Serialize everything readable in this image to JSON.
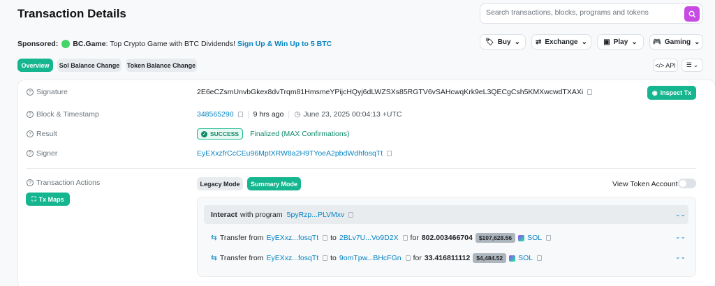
{
  "header": {
    "title": "Transaction Details",
    "search_placeholder": "Search transactions, blocks, programs and tokens"
  },
  "sponsor": {
    "prefix": "Sponsored:",
    "brand": "BC.Game",
    "text": ": Top Crypto Game with BTC Dividends!",
    "cta": "Sign Up & Win Up to 5 BTC"
  },
  "nav_pills": [
    {
      "label": "Buy",
      "icon": "tag-icon"
    },
    {
      "label": "Exchange",
      "icon": "exchange-icon"
    },
    {
      "label": "Play",
      "icon": "play-icon"
    },
    {
      "label": "Gaming",
      "icon": "gamepad-icon"
    }
  ],
  "tabs": {
    "overview": "Overview",
    "sol_balance": "Sol Balance Change",
    "token_balance": "Token Balance Change"
  },
  "api_label": "API",
  "details": {
    "signature_label": "Signature",
    "signature": "2E6eCZsmUnvbGkex8dvTrqm81HmsmeYPijcHQyj6dLWZSXs85RGTV6vSAHcwqKrk9eL3QECgCsh5KMXwcwdTXAXi",
    "inspect_label": "Inspect Tx",
    "block_label": "Block & Timestamp",
    "block": "348565290",
    "age": "9 hrs ago",
    "timestamp": "June 23, 2025 00:04:13 +UTC",
    "result_label": "Result",
    "result_badge": "SUCCESS",
    "result_text": "Finalized (MAX Confirmations)",
    "signer_label": "Signer",
    "signer": "EyEXxzfrCcCEu96MptXRW8a2H9TYoeA2pbdWdhfosqTt"
  },
  "actions": {
    "label": "Transaction Actions",
    "tx_maps": "Tx Maps",
    "legacy_mode": "Legacy Mode",
    "summary_mode": "Summary Mode",
    "view_token_account": "View Token Account",
    "interact_bold": "Interact",
    "interact_text": "with program",
    "program": "5pyRzp...PLVMxv",
    "transfers": [
      {
        "from_text": "Transfer from",
        "from": "EyEXxz...fosqTt",
        "to_text": "to",
        "to": "2BLv7U...Vo9D2X",
        "for_text": "for",
        "amount": "802.003466704",
        "usd": "$107,628.56",
        "token": "SOL"
      },
      {
        "from_text": "Transfer from",
        "from": "EyEXxz...fosqTt",
        "to_text": "to",
        "to": "9omTpw...BHcFGn",
        "for_text": "for",
        "amount": "33.416811112",
        "usd": "$4,484.52",
        "token": "SOL"
      }
    ]
  },
  "colors": {
    "accent": "#15b68f",
    "link": "#0784c3",
    "search": "#c74ae3"
  }
}
